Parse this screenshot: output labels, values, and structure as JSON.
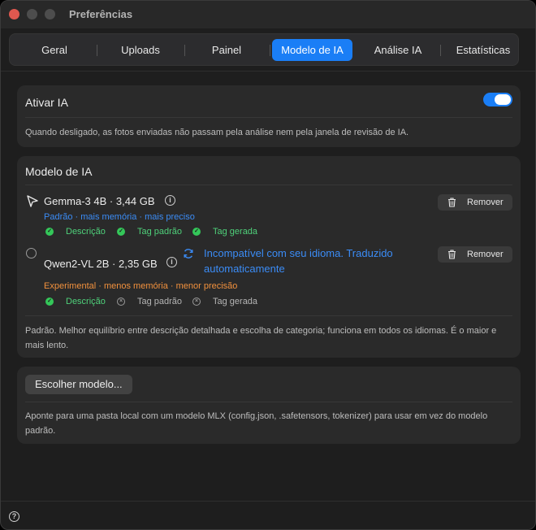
{
  "window": {
    "title": "Preferências"
  },
  "tabs": [
    {
      "label": "Geral"
    },
    {
      "label": "Uploads"
    },
    {
      "label": "Painel"
    },
    {
      "label": "Modelo de IA"
    },
    {
      "label": "Análise IA"
    },
    {
      "label": "Estatísticas"
    }
  ],
  "active_tab": "Modelo de IA",
  "enable_ai": {
    "label": "Ativar IA",
    "enabled": true,
    "description": "Quando desligado, as fotos enviadas não passam pela análise nem pela janela de revisão de IA."
  },
  "models_section": {
    "title": "Modelo de IA",
    "models": [
      {
        "name": "Gemma-3 4B · 3,44 GB",
        "selected": true,
        "tags": "Padrão · mais memória · mais preciso",
        "features": [
          {
            "label": "Descrição",
            "supported": true
          },
          {
            "label": "Tag padrão",
            "supported": true
          },
          {
            "label": "Tag gerada",
            "supported": true
          }
        ],
        "remove_label": "Remover"
      },
      {
        "name": "Qwen2-VL 2B · 2,35 GB",
        "selected": false,
        "warning": "Incompatível com seu idioma. Traduzido automaticamente",
        "tags": "Experimental · menos memória · menor precisão",
        "features": [
          {
            "label": "Descrição",
            "supported": true
          },
          {
            "label": "Tag padrão",
            "supported": false
          },
          {
            "label": "Tag gerada",
            "supported": false
          }
        ],
        "remove_label": "Remover"
      }
    ],
    "description": "Padrão. Melhor equilíbrio entre descrição detalhada e escolha de categoria; funciona em todos os idiomas. É o maior e mais lento."
  },
  "custom_model": {
    "button_label": "Escolher modelo...",
    "description": "Aponte para uma pasta local com um modelo MLX (config.json, .safetensors, tokenizer) para usar em vez do modelo padrão."
  },
  "footer": {
    "help_icon": "question-circle-icon"
  },
  "colors": {
    "accent": "#1a7ef6",
    "success": "#34c759",
    "warning_text": "#f2913d"
  }
}
